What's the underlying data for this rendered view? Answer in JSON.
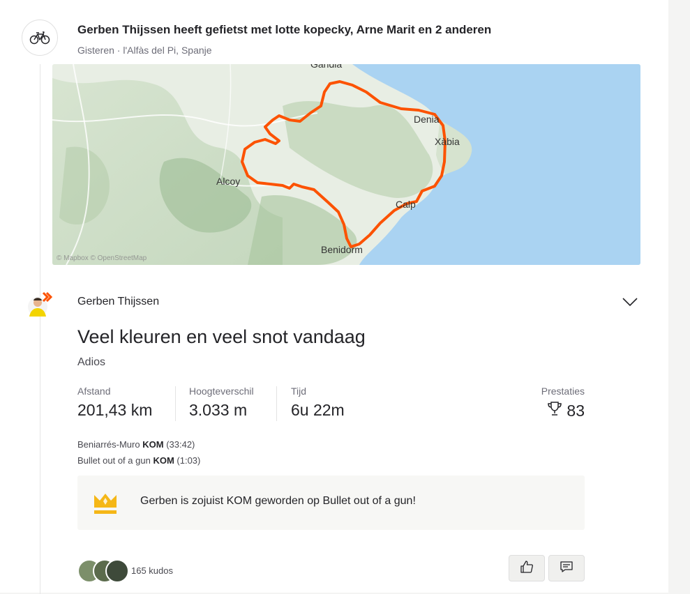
{
  "group": {
    "icon": "bike-icon",
    "title": "Gerben Thijssen heeft gefietst met lotte kopecky, Arne  Marit en 2 anderen",
    "subtitle": "Gisteren · l'Alfàs del Pi, Spanje"
  },
  "map": {
    "labels": [
      "Gandia",
      "Denia",
      "Xàbia",
      "Alcoy",
      "Calp",
      "Benidorm"
    ],
    "attribution": "© Mapbox © OpenStreetMap",
    "route_color": "#fc5200",
    "sea_color": "#aad3f2"
  },
  "activity": {
    "athlete_name": "Gerben Thijssen",
    "title": "Veel kleuren en veel snot vandaag",
    "description": "Adios",
    "stats": [
      {
        "label": "Afstand",
        "value": "201,43 km"
      },
      {
        "label": "Hoogteverschil",
        "value": "3.033 m"
      },
      {
        "label": "Tijd",
        "value": "6u 22m"
      }
    ],
    "achievements": {
      "label": "Prestaties",
      "value": "83",
      "icon": "trophy-icon"
    },
    "segments": [
      {
        "name": "Beniarrés-Muro",
        "badge": "KOM",
        "time": "(33:42)"
      },
      {
        "name": "Bullet out of a gun",
        "badge": "KOM",
        "time": "(1:03)"
      }
    ],
    "banner": {
      "icon": "crown-icon",
      "text": "Gerben is zojuist KOM geworden op Bullet out of a gun!"
    },
    "kudos": {
      "count_text": "165 kudos"
    },
    "buttons": {
      "kudo_icon": "thumbs-up-icon",
      "comment_icon": "comment-icon"
    }
  }
}
